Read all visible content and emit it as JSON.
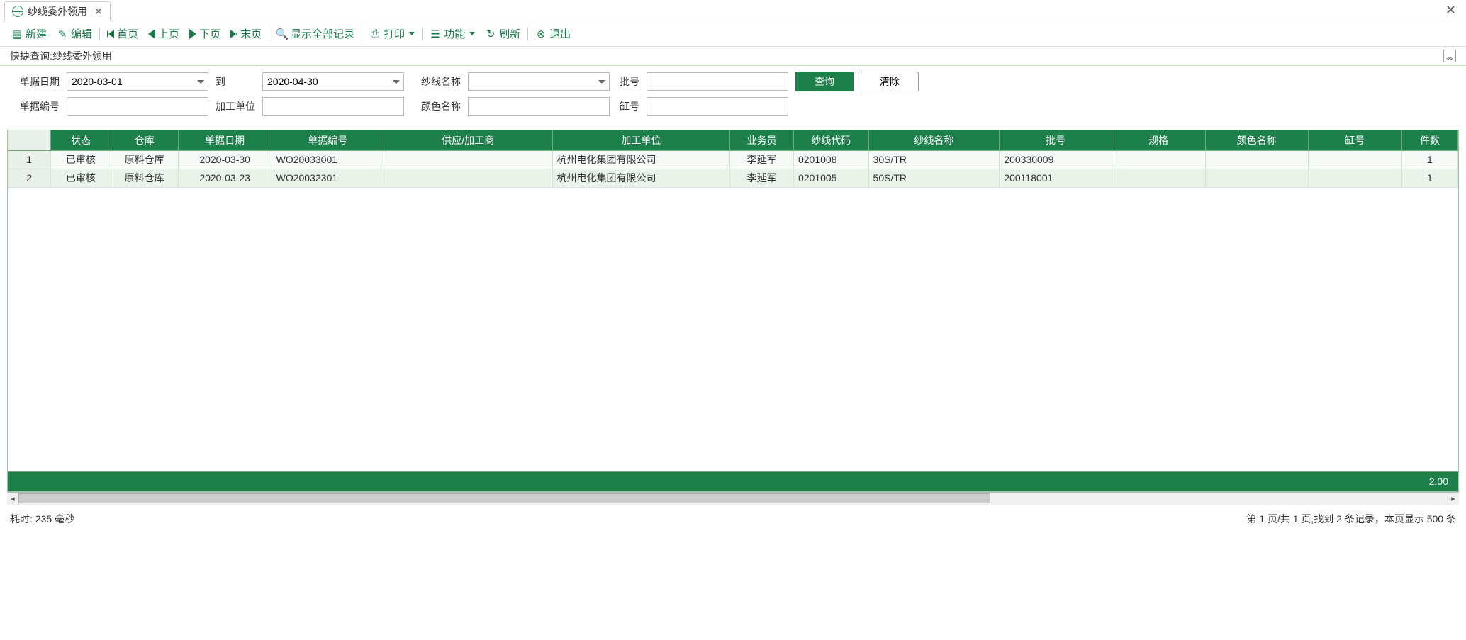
{
  "tabs": {
    "items": [
      {
        "title": "纱线委外领用"
      }
    ]
  },
  "toolbar": {
    "new": "新建",
    "edit": "编辑",
    "first": "首页",
    "prev": "上页",
    "next": "下页",
    "last": "末页",
    "show_all": "显示全部记录",
    "print": "打印",
    "func": "功能",
    "refresh": "刷新",
    "exit": "退出"
  },
  "quick_query": {
    "label": "快捷查询:纱线委外领用"
  },
  "filter": {
    "labels": {
      "doc_date": "单据日期",
      "to": "到",
      "yarn_name": "纱线名称",
      "batch": "批号",
      "doc_no": "单据编号",
      "proc_unit": "加工单位",
      "color_name": "颜色名称",
      "vat_no": "缸号"
    },
    "values": {
      "date_from": "2020-03-01",
      "date_to": "2020-04-30",
      "yarn_name": "",
      "batch": "",
      "doc_no": "",
      "proc_unit": "",
      "color_name": "",
      "vat_no": ""
    },
    "buttons": {
      "query": "查询",
      "clear": "清除"
    }
  },
  "grid": {
    "columns": [
      "状态",
      "仓库",
      "单据日期",
      "单据编号",
      "供应/加工商",
      "加工单位",
      "业务员",
      "纱线代码",
      "纱线名称",
      "批号",
      "规格",
      "颜色名称",
      "缸号",
      "件数"
    ],
    "rows": [
      {
        "status": "已审核",
        "warehouse": "原料仓库",
        "doc_date": "2020-03-30",
        "doc_no": "WO20033001",
        "supplier": "",
        "proc_unit": "杭州电化集团有限公司",
        "salesman": "李延军",
        "yarn_code": "0201008",
        "yarn_name": "30S/TR",
        "batch": "200330009",
        "spec": "",
        "color_name": "",
        "vat_no": "",
        "pieces": "1"
      },
      {
        "status": "已审核",
        "warehouse": "原料仓库",
        "doc_date": "2020-03-23",
        "doc_no": "WO20032301",
        "supplier": "",
        "proc_unit": "杭州电化集团有限公司",
        "salesman": "李延军",
        "yarn_code": "0201005",
        "yarn_name": "50S/TR",
        "batch": "200118001",
        "spec": "",
        "color_name": "",
        "vat_no": "",
        "pieces": "1"
      }
    ],
    "summary": {
      "total_pieces": "2.00"
    }
  },
  "status": {
    "elapsed": "耗时: 235 毫秒",
    "paging": "第 1 页/共 1 页,找到 2 条记录，本页显示 500 条"
  }
}
